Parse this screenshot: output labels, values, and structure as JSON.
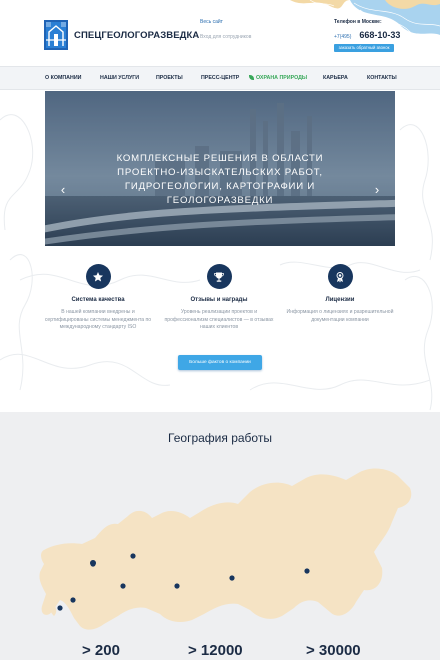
{
  "header": {
    "logo_text": "СПЕЦГЕОЛОГОРАЗВЕДКА",
    "link_all_site": "Весь сайт",
    "link_staff_login": "Вход для сотрудников",
    "phone_caption": "Телефон в Москве:",
    "phone_code": "+7(495)",
    "phone_number": "668-10-33",
    "callback_button": "заказать обратный звонок"
  },
  "nav": {
    "items": [
      "О КОМПАНИИ",
      "НАШИ УСЛУГИ",
      "ПРОЕКТЫ",
      "ПРЕСС-ЦЕНТР",
      "ОХРАНА ПРИРОДЫ",
      "КАРЬЕРА",
      "КОНТАКТЫ"
    ]
  },
  "hero": {
    "title": "КОМПЛЕКСНЫЕ РЕШЕНИЯ В ОБЛАСТИ ПРОЕКТНО-ИЗЫСКАТЕЛЬСКИХ РАБОТ, ГИДРОГЕОЛОГИИ, КАРТОГРАФИИ И ГЕОЛОГОРАЗВЕДКИ",
    "prev_arrow": "‹",
    "next_arrow": "›"
  },
  "features": [
    {
      "icon": "star-icon",
      "title": "Система качества",
      "text": "В нашей компании внедрены и сертифицированы системы менеджмента по международному стандарту ISO"
    },
    {
      "icon": "trophy-icon",
      "title": "Отзывы и награды",
      "text": "Уровень реализации проектов и профессионализм специалистов — в отзывах наших клиентов"
    },
    {
      "icon": "medal-icon",
      "title": "Лицензии",
      "text": "Информация о лицензиях и разрешительной документации компании"
    }
  ],
  "more_button": "Больше фактов о компании",
  "geography": {
    "title": "География работы",
    "map_color": "#f5e3c4",
    "marker_color": "#18365e"
  },
  "stats": [
    {
      "value": "> 200"
    },
    {
      "value": "> 12000"
    },
    {
      "value": "> 30000"
    }
  ],
  "colors": {
    "brand_dark": "#1b2b44",
    "accent_blue": "#3aa0e0",
    "nature_green": "#39a85a",
    "icon_circle": "#18365e"
  }
}
